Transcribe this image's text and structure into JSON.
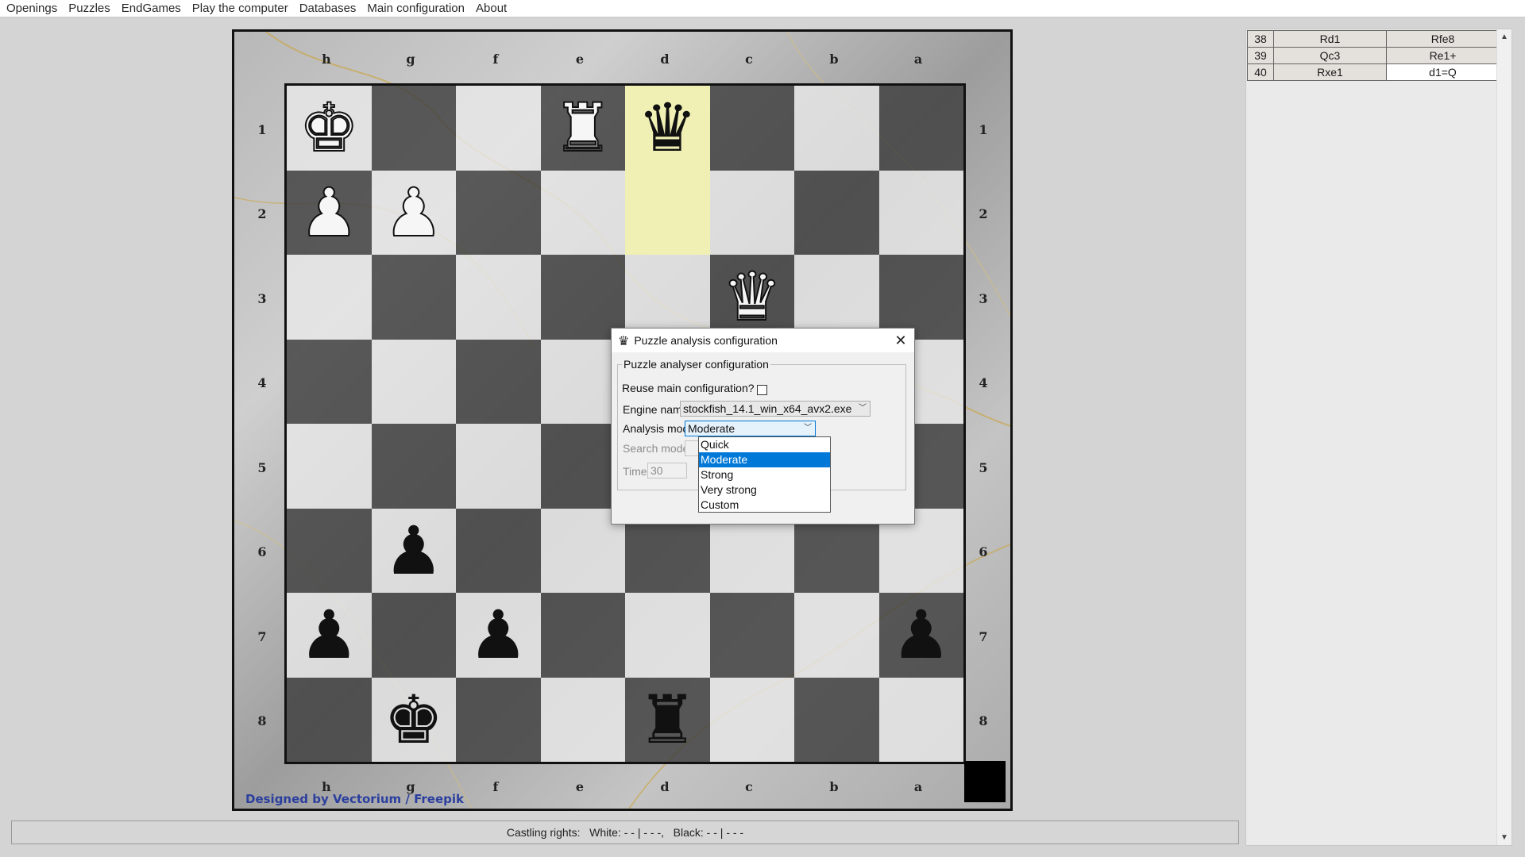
{
  "menu": [
    "Openings",
    "Puzzles",
    "EndGames",
    "Play the computer",
    "Databases",
    "Main configuration",
    "About"
  ],
  "board": {
    "files": [
      "h",
      "g",
      "f",
      "e",
      "d",
      "c",
      "b",
      "a"
    ],
    "ranks": [
      "1",
      "2",
      "3",
      "4",
      "5",
      "6",
      "7",
      "8"
    ],
    "credit": "Designed by Vectorium / Freepik"
  },
  "status": {
    "castling": "Castling rights:   White: - - | - - -,   Black: - - | - - -"
  },
  "moves": [
    {
      "num": "38",
      "white": "Rd1",
      "black": "Rfe8"
    },
    {
      "num": "39",
      "white": "Qc3",
      "black": "Re1+"
    },
    {
      "num": "40",
      "white": "Rxe1",
      "black": "d1=Q"
    }
  ],
  "dialog": {
    "title": "Puzzle analysis configuration",
    "group_label": "Puzzle analyser configuration",
    "reuse_label": "Reuse main configuration?",
    "engine_label": "Engine name:",
    "engine_value": "stockfish_14.1_win_x64_avx2.exe",
    "analysis_label": "Analysis mode:",
    "analysis_value": "Moderate",
    "search_label": "Search mode:",
    "time_label": "Time:",
    "time_value": "30",
    "analysis_options": [
      "Quick",
      "Moderate",
      "Strong",
      "Very strong",
      "Custom"
    ]
  }
}
